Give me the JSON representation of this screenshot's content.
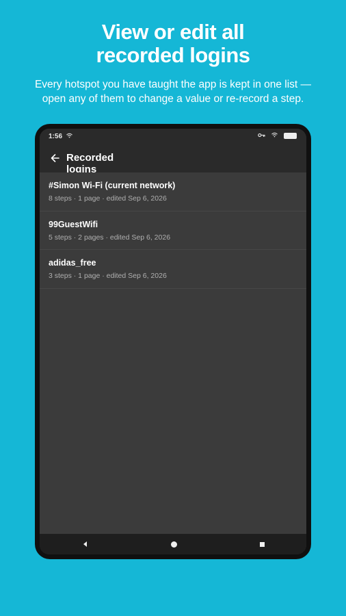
{
  "headline": {
    "line1": "View or edit all",
    "line2": "recorded logins"
  },
  "subhead": {
    "line1": "Every hotspot you have taught the app is kept in one list —",
    "line2": "open any of them to change a value or re-record a step."
  },
  "status_bar": {
    "time": "1:56",
    "icons": [
      "wifi-icon",
      "key-icon",
      "wifi-icon",
      "battery-icon"
    ]
  },
  "app_bar": {
    "title": "Recorded logins",
    "back_icon": "arrow-left-icon"
  },
  "logins": [
    {
      "title": "#Simon Wi-Fi (current network)",
      "meta": "8 steps · 1 page · edited Sep 6, 2026"
    },
    {
      "title": "99GuestWifi",
      "meta": "5 steps · 2 pages · edited Sep 6, 2026"
    },
    {
      "title": "adidas_free",
      "meta": "3 steps · 1 page · edited Sep 6, 2026"
    }
  ],
  "nav_bar": {
    "icons": [
      "back-triangle-icon",
      "home-circle-icon",
      "recents-square-icon"
    ]
  },
  "colors": {
    "background": "#15b7d6",
    "screen": "#3b3b3b",
    "app_bar": "#2a2a2a"
  }
}
